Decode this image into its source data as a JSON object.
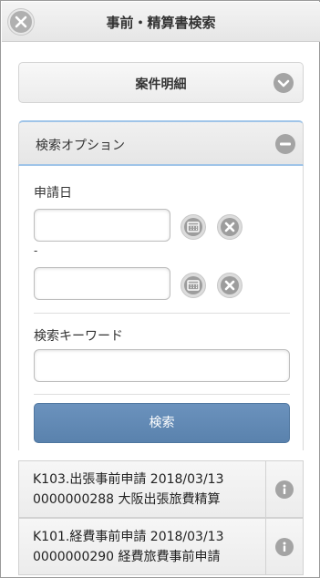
{
  "header": {
    "title": "事前・精算書検索"
  },
  "sections": {
    "details": {
      "label": "案件明細"
    },
    "options": {
      "label": "検索オプション"
    }
  },
  "form": {
    "date_label": "申請日",
    "date_separator": "-",
    "keyword_label": "検索キーワード",
    "date_from_value": "",
    "date_to_value": "",
    "keyword_value": "",
    "search_button": "検索"
  },
  "results": [
    {
      "line1": "K103.出張事前申請 2018/03/13",
      "line2": "0000000288 大阪出張旅費精算"
    },
    {
      "line1": "K101.経費事前申請 2018/03/13",
      "line2": "0000000290 経費旅費事前申請"
    }
  ],
  "icons": {
    "close": "close-icon",
    "expand": "chevron-down-icon",
    "collapse": "minus-icon",
    "calendar": "calendar-icon",
    "clear": "clear-icon",
    "info": "info-icon"
  },
  "colors": {
    "accent_blue": "#5f87b3",
    "section_border": "#9fc4e8",
    "icon_gray": "#a4a4a4"
  }
}
